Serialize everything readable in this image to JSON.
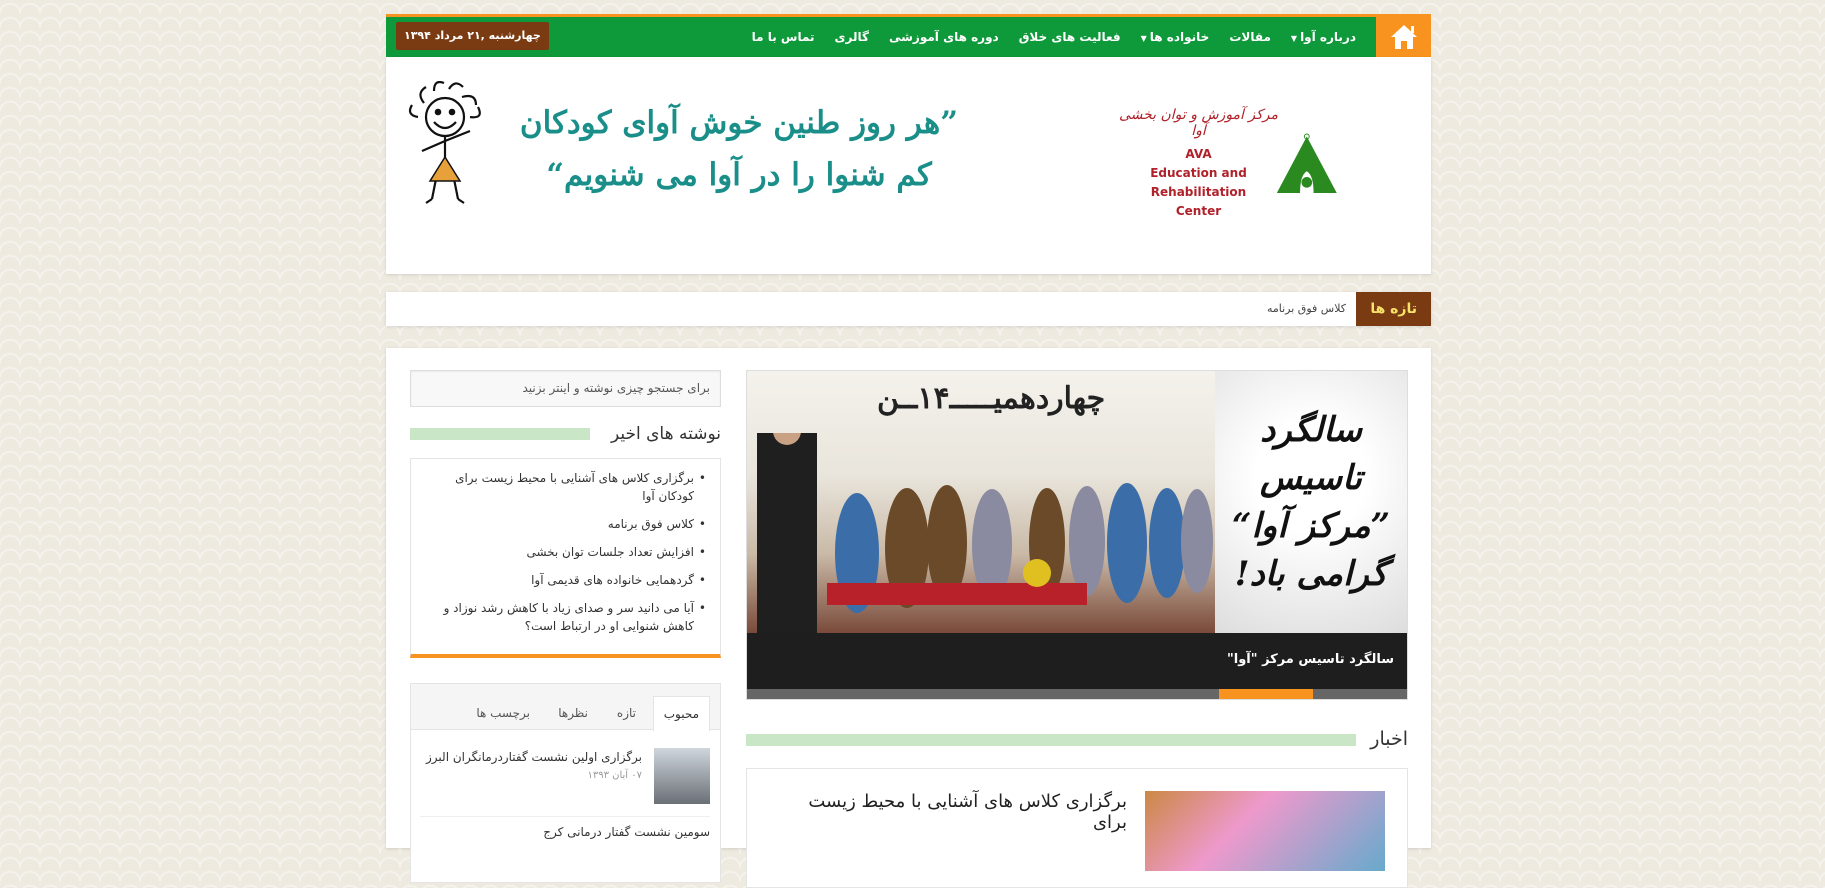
{
  "nav": {
    "items": [
      {
        "label": "درباره آوا",
        "has_caret": true
      },
      {
        "label": "مقالات",
        "has_caret": false
      },
      {
        "label": "خانواده ها",
        "has_caret": true
      },
      {
        "label": "فعالیت های خلاق",
        "has_caret": false
      },
      {
        "label": "دوره های آموزشی",
        "has_caret": false
      },
      {
        "label": "گالری",
        "has_caret": false
      },
      {
        "label": "تماس با ما",
        "has_caret": false
      }
    ],
    "date": "چهارشنبه ,۲۱ مرداد ۱۳۹۴",
    "accent": "#f7931e",
    "bg": "#0e9a3b"
  },
  "header": {
    "logo_fa": "مرکز آموزش و توان بخشی آوا",
    "logo_en_1": "AVA",
    "logo_en_2": "Education and Rehabilitation",
    "logo_en_3": "Center",
    "slogan_1": "”هر روز طنین خوش آوای کودکان",
    "slogan_2": "کم شنوا را در آوا می شنویم“"
  },
  "ticker": {
    "label": "تازه ها",
    "item": "کلاس فوق برنامه"
  },
  "slider": {
    "photo_title": "چهاردهمیـــــ۱۴ــن",
    "poster_lines": [
      "سالگرد",
      "تاسیس",
      "”مرکز آوا“",
      "گرامی باد!"
    ],
    "caption": "سالگرد تاسیس مرکز \"آوا\""
  },
  "news": {
    "heading": "اخبار",
    "first_title": "برگزاری کلاس های آشنایی با محیط زیست برای"
  },
  "search": {
    "placeholder": "برای جستجو چیزی نوشته و اینتر بزنید"
  },
  "recent": {
    "heading": "نوشته های اخیر",
    "items": [
      "برگزاری کلاس های آشنایی با محیط زیست برای کودکان آوا",
      "کلاس فوق برنامه",
      "افزایش تعداد جلسات توان بخشی",
      "گردهمایی خانواده های قدیمی آوا",
      "آیا می دانید سر و صدای زیاد با کاهش رشد نوزاد و کاهش شنوایی او در ارتباط است؟"
    ]
  },
  "tabs": {
    "labels": [
      "محبوب",
      "تازه",
      "نظرها",
      "برچسب ها"
    ],
    "popular_1_title": "برگزاری اولین نشست گفتاردرمانگران البرز",
    "popular_1_date": "۰۷ آبان ۱۳۹۳",
    "popular_2_title": "سومین نشست گفتار درمانی کرج"
  }
}
